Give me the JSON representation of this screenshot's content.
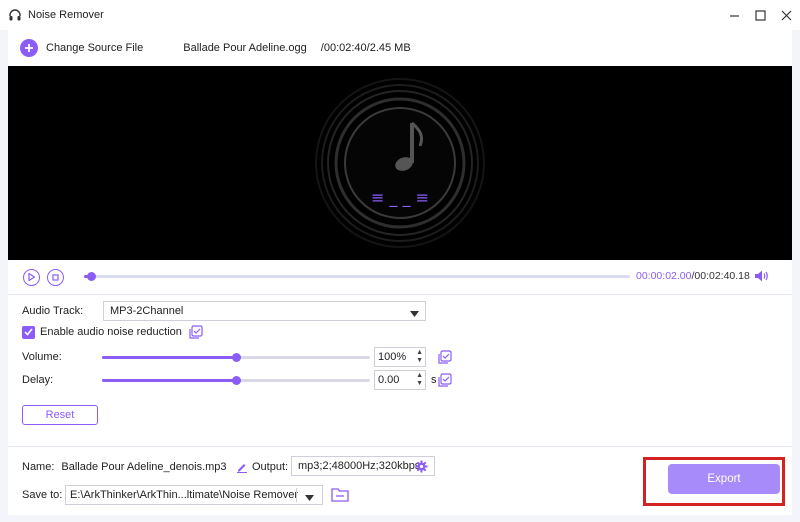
{
  "window": {
    "title": "Noise Remover",
    "minimize_glyph": "—",
    "maximize_glyph": "☐",
    "close_glyph": "✕"
  },
  "toolbar": {
    "change_source_label": "Change Source File",
    "file_name": "Ballade Pour Adeline.ogg",
    "file_meta": "/00:02:40/2.45 MB"
  },
  "player": {
    "wave_glyph": "≡ _ _ ≡",
    "current_time": "00:00:02.00",
    "total_time": "/00:02:40.18",
    "progress": 0.0125
  },
  "settings": {
    "audio_track_label": "Audio Track:",
    "audio_track_value": "MP3-2Channel",
    "noise_reduction_label": "Enable audio noise reduction",
    "noise_reduction_checked": true,
    "volume_label": "Volume:",
    "volume_value": "100%",
    "volume_level": 0.5,
    "delay_label": "Delay:",
    "delay_value": "0.00",
    "delay_unit": "s",
    "delay_level": 0.5,
    "reset_label": "Reset"
  },
  "bottom": {
    "name_label": "Name:",
    "name_value": "Ballade Pour Adeline_denois.mp3",
    "output_label": "Output:",
    "output_value": "mp3;2;48000Hz;320kbps",
    "save_to_label": "Save to:",
    "save_to_value": "E:\\ArkThinker\\ArkThin...ltimate\\Noise Remover",
    "export_label": "Export"
  },
  "colors": {
    "accent": "#8b5cf6",
    "export_button": "#a78bfa",
    "highlight_box": "#d32222",
    "player_bg": "#000000"
  }
}
